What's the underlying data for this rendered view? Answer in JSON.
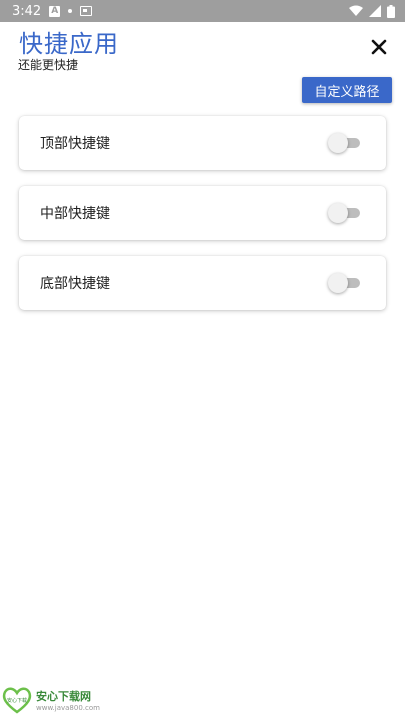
{
  "status_bar": {
    "time": "3:42",
    "icons": [
      "a-notification-icon",
      "dot-icon",
      "sim-card-icon",
      "wifi-icon",
      "signal-icon",
      "battery-icon"
    ]
  },
  "header": {
    "title": "快捷应用",
    "subtitle": "还能更快捷",
    "close_icon": "close-icon"
  },
  "actions": {
    "custom_path_label": "自定义路径"
  },
  "shortcuts": [
    {
      "label": "顶部快捷键",
      "enabled": false
    },
    {
      "label": "中部快捷键",
      "enabled": false
    },
    {
      "label": "底部快捷键",
      "enabled": false
    }
  ],
  "watermark": {
    "name": "安心下载网",
    "url": "www.java800.com",
    "logo_text": "安心下载"
  },
  "colors": {
    "accent": "#3a68c9",
    "status_bar": "#9e9e9e",
    "toggle_off_track": "#bdbdbd",
    "toggle_off_thumb": "#f1f1f1"
  }
}
